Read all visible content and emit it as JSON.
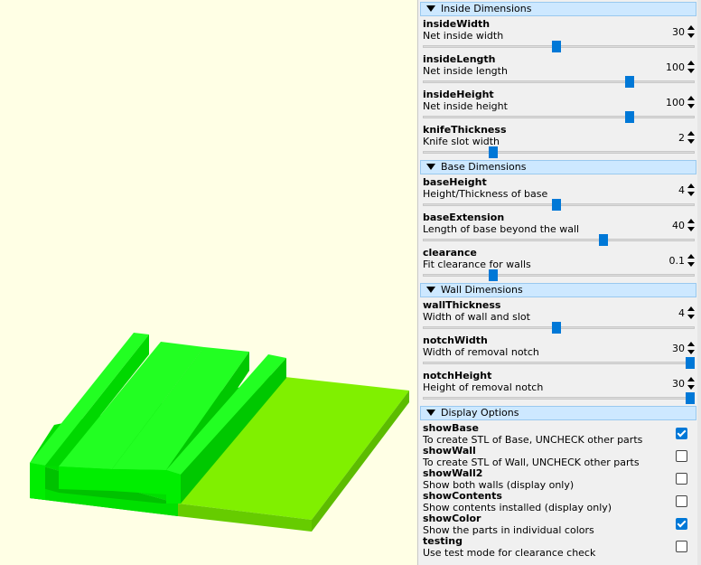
{
  "viewport": {
    "background": "#ffffe5",
    "colors": {
      "base": "#7ff000",
      "wall": "#00ee00",
      "wall_dark": "#00c000"
    }
  },
  "groups": [
    {
      "title": "Inside Dimensions",
      "params": [
        {
          "name": "insideWidth",
          "desc": "Net inside width",
          "value": "30",
          "slider": 0.49
        },
        {
          "name": "insideLength",
          "desc": "Net inside length",
          "value": "100",
          "slider": 0.77
        },
        {
          "name": "insideHeight",
          "desc": "Net inside height",
          "value": "100",
          "slider": 0.77
        },
        {
          "name": "knifeThickness",
          "desc": "Knife slot width",
          "value": "2",
          "slider": 0.25
        }
      ]
    },
    {
      "title": "Base Dimensions",
      "params": [
        {
          "name": "baseHeight",
          "desc": "Height/Thickness of base",
          "value": "4",
          "slider": 0.49
        },
        {
          "name": "baseExtension",
          "desc": "Length of base beyond the wall",
          "value": "40",
          "slider": 0.67
        },
        {
          "name": "clearance",
          "desc": "Fit clearance for walls",
          "value": "0.1",
          "slider": 0.25
        }
      ]
    },
    {
      "title": "Wall Dimensions",
      "params": [
        {
          "name": "wallThickness",
          "desc": "Width of wall and slot",
          "value": "4",
          "slider": 0.49
        },
        {
          "name": "notchWidth",
          "desc": "Width of removal notch",
          "value": "30",
          "slider": 1.0
        },
        {
          "name": "notchHeight",
          "desc": "Height of removal notch",
          "value": "30",
          "slider": 1.0
        }
      ]
    },
    {
      "title": "Display Options",
      "checks": [
        {
          "name": "showBase",
          "desc": "To create STL of Base, UNCHECK other parts",
          "checked": true
        },
        {
          "name": "showWall",
          "desc": "To create STL of Wall, UNCHECK other parts",
          "checked": false
        },
        {
          "name": "showWall2",
          "desc": "Show both walls (display only)",
          "checked": false
        },
        {
          "name": "showContents",
          "desc": "Show contents installed (display only)",
          "checked": false
        },
        {
          "name": "showColor",
          "desc": "Show the parts in individual colors",
          "checked": true
        },
        {
          "name": "testing",
          "desc": "Use test mode for clearance check",
          "checked": false
        }
      ]
    }
  ]
}
